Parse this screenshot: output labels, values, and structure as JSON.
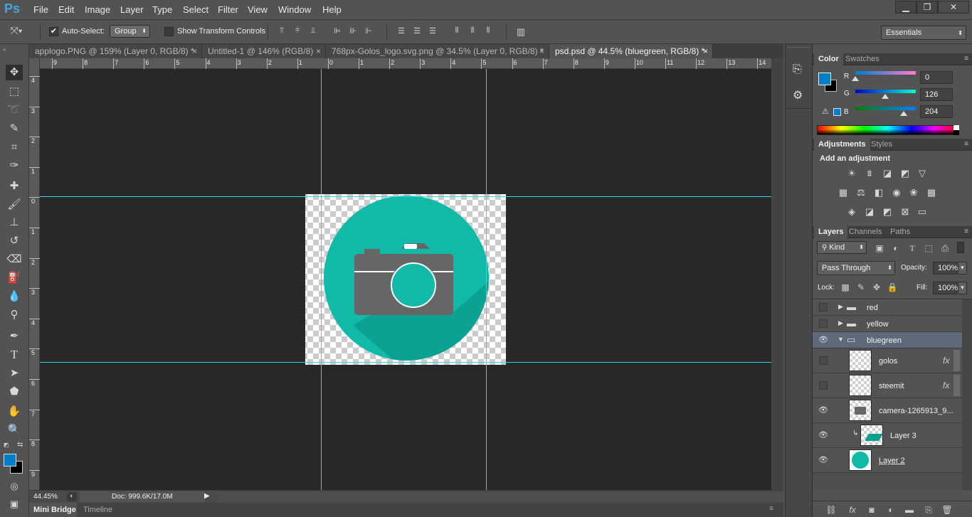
{
  "app": {
    "logo": "Ps"
  },
  "menu": [
    "File",
    "Edit",
    "Image",
    "Layer",
    "Type",
    "Select",
    "Filter",
    "View",
    "Window",
    "Help"
  ],
  "window_controls": {
    "minimize": "▁",
    "restore": "❐",
    "close": "✕"
  },
  "options": {
    "auto_select_label": "Auto-Select:",
    "auto_select_checked": true,
    "auto_select_target": "Group",
    "transform_label": "Show Transform Controls",
    "transform_checked": false,
    "workspace": "Essentials"
  },
  "tabs": [
    {
      "label": "applogo.PNG @ 159% (Layer 0, RGB/8) *",
      "close": "×",
      "active": false
    },
    {
      "label": "Untitled-1 @ 146% (RGB/8)",
      "close": "×",
      "active": false
    },
    {
      "label": "768px-Golos_logo.svg.png @ 34.5% (Layer 0, RGB/8) *",
      "close": "×",
      "active": false
    },
    {
      "label": "psd.psd @ 44.5% (bluegreen, RGB/8) *",
      "close": "×",
      "active": true
    }
  ],
  "rulers": {
    "h_labels": [
      "9",
      "8",
      "7",
      "6",
      "5",
      "4",
      "3",
      "2",
      "1",
      "0",
      "1",
      "2",
      "3",
      "4",
      "5",
      "6",
      "7",
      "8",
      "9",
      "10",
      "11",
      "12",
      "13",
      "14"
    ],
    "v_labels": [
      "4",
      "3",
      "2",
      "1",
      "0",
      "1",
      "2",
      "3",
      "4",
      "5",
      "6",
      "7",
      "8",
      "9"
    ]
  },
  "status": {
    "zoom": "44.45%",
    "doc": "Doc: 999.6K/17.0M"
  },
  "bottom_tabs": [
    "Mini Bridge",
    "Timeline"
  ],
  "color_panel": {
    "tabs": [
      "Color",
      "Swatches"
    ],
    "foreground": "#007ecc",
    "background": "#000000",
    "r_label": "R",
    "g_label": "G",
    "b_label": "B",
    "r": "0",
    "g": "126",
    "b": "204",
    "r_fraction": 0.0,
    "g_fraction": 0.494,
    "b_fraction": 0.8
  },
  "adjustments": {
    "tabs": [
      "Adjustments",
      "Styles"
    ],
    "heading": "Add an adjustment",
    "row1": [
      "brightness-icon",
      "levels-icon",
      "curves-icon",
      "exposure-icon",
      "vibrance-icon"
    ],
    "row2": [
      "hue-sat-icon",
      "color-balance-icon",
      "black-white-icon",
      "photo-filter-icon",
      "channel-mixer-icon",
      "color-lookup-icon"
    ],
    "row3": [
      "invert-icon",
      "posterize-icon",
      "threshold-icon",
      "selective-color-icon",
      "gradient-map-icon"
    ]
  },
  "layers_panel": {
    "tabs": [
      "Layers",
      "Channels",
      "Paths"
    ],
    "filter_kind": "Kind",
    "blend_mode": "Pass Through",
    "opacity_label": "Opacity:",
    "opacity": "100%",
    "lock_label": "Lock:",
    "fill_label": "Fill:",
    "fill": "100%",
    "groups": [
      {
        "name": "red",
        "visible": false,
        "expanded": false
      },
      {
        "name": "yellow",
        "visible": false,
        "expanded": false
      },
      {
        "name": "bluegreen",
        "visible": true,
        "expanded": true
      }
    ],
    "layers": [
      {
        "name": "golos",
        "visible": false,
        "fx": "fx"
      },
      {
        "name": "steemit",
        "visible": false,
        "fx": "fx"
      },
      {
        "name": "camera-1265913_9...",
        "visible": true,
        "fx": ""
      },
      {
        "name": "Layer 3",
        "visible": true,
        "fx": "",
        "clipped": true
      },
      {
        "name": "Layer 2",
        "visible": true,
        "fx": ""
      }
    ],
    "bottom_icons": [
      "link-icon",
      "fx-icon",
      "mask-icon",
      "adjustment-layer-icon",
      "folder-icon",
      "new-layer-icon",
      "trash-icon"
    ]
  },
  "colors": {
    "teal": "#10b9a8",
    "guide": "#39d5e6",
    "canvas_bg": "#282828"
  }
}
